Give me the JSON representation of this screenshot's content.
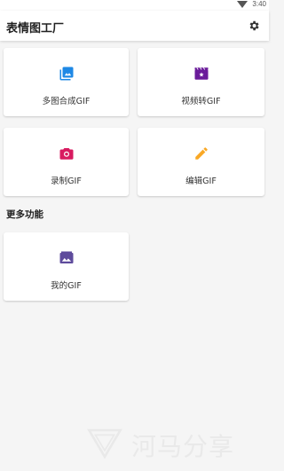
{
  "status_bar": {
    "time": "3:40"
  },
  "app_bar": {
    "title": "表情图工厂"
  },
  "cards": [
    {
      "label": "多图合成GIF",
      "icon": "gallery-icon",
      "color": "#1e88e5"
    },
    {
      "label": "视频转GIF",
      "icon": "video-clapper-icon",
      "color": "#6a1b9a"
    },
    {
      "label": "录制GIF",
      "icon": "camera-icon",
      "color": "#d81b60"
    },
    {
      "label": "编辑GIF",
      "icon": "pencil-icon",
      "color": "#f9a825"
    }
  ],
  "more": {
    "title": "更多功能",
    "cards": [
      {
        "label": "我的GIF",
        "icon": "my-gif-icon",
        "color": "#5e4b9c"
      }
    ]
  },
  "watermark": {
    "text": "河马分享"
  }
}
